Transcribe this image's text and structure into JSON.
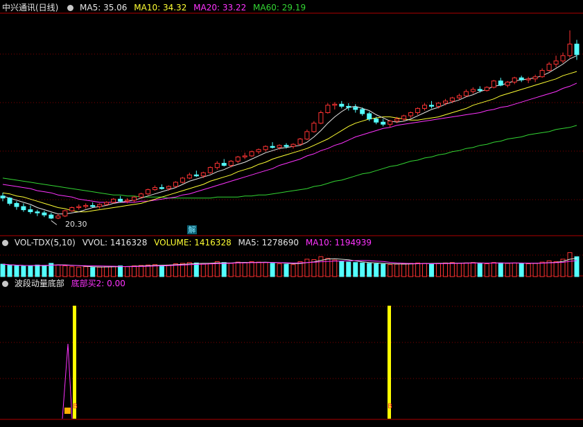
{
  "main": {
    "title": "中兴通讯(日线)",
    "ma5": "MA5: 35.06",
    "ma10": "MA10: 34.32",
    "ma20": "MA20: 33.22",
    "ma60": "MA60: 29.19",
    "low_label": "20.30",
    "unlock_label": "解"
  },
  "volume": {
    "title": "VOL-TDX(5,10)",
    "vvol": "VVOL: 1416328",
    "vol": "VOLUME: 1416328",
    "ma5": "MA5: 1278690",
    "ma10": "MA10: 1194939"
  },
  "indicator": {
    "title": "波段动量底部",
    "buy2": "底部买2: 0.00",
    "marker": "B"
  },
  "colors": {
    "up": "#ff3333",
    "down": "#54ffff",
    "ma5": "#e6e6e6",
    "ma10": "#ffff33",
    "ma20": "#ff33ff",
    "ma60": "#33d633",
    "grid": "#880000",
    "signal": "#ffff00"
  },
  "chart_data": [
    {
      "type": "candlestick",
      "name": "price",
      "low_marked": 20.3,
      "ohlc": [
        [
          22.5,
          22.8,
          22.0,
          22.3
        ],
        [
          22.3,
          22.4,
          21.6,
          21.8
        ],
        [
          21.8,
          22.0,
          21.2,
          21.5
        ],
        [
          21.5,
          21.8,
          21.0,
          21.2
        ],
        [
          21.2,
          21.6,
          20.8,
          21.0
        ],
        [
          21.0,
          21.2,
          20.6,
          20.9
        ],
        [
          20.9,
          21.1,
          20.5,
          20.7
        ],
        [
          20.7,
          20.9,
          20.3,
          20.4
        ],
        [
          20.4,
          20.8,
          20.3,
          20.6
        ],
        [
          20.6,
          21.2,
          20.5,
          21.1
        ],
        [
          21.1,
          21.5,
          21.0,
          21.4
        ],
        [
          21.4,
          21.7,
          21.2,
          21.5
        ],
        [
          21.5,
          21.8,
          21.3,
          21.6
        ],
        [
          21.6,
          21.9,
          21.4,
          21.5
        ],
        [
          21.5,
          21.8,
          21.3,
          21.7
        ],
        [
          21.7,
          22.0,
          21.6,
          21.9
        ],
        [
          21.9,
          22.3,
          21.8,
          22.2
        ],
        [
          22.2,
          22.5,
          21.9,
          22.0
        ],
        [
          22.0,
          22.3,
          21.8,
          22.1
        ],
        [
          22.1,
          22.5,
          21.9,
          22.4
        ],
        [
          22.4,
          22.8,
          22.3,
          22.7
        ],
        [
          22.7,
          23.2,
          22.6,
          23.1
        ],
        [
          23.1,
          23.5,
          23.0,
          23.3
        ],
        [
          23.3,
          23.6,
          23.1,
          23.2
        ],
        [
          23.2,
          23.5,
          23.0,
          23.4
        ],
        [
          23.4,
          23.9,
          23.3,
          23.8
        ],
        [
          23.8,
          24.3,
          23.7,
          24.2
        ],
        [
          24.2,
          24.7,
          24.1,
          24.5
        ],
        [
          24.5,
          24.9,
          24.3,
          24.4
        ],
        [
          24.4,
          24.8,
          24.2,
          24.7
        ],
        [
          24.7,
          25.3,
          24.6,
          25.2
        ],
        [
          25.2,
          25.8,
          25.0,
          25.6
        ],
        [
          25.6,
          26.0,
          25.3,
          25.4
        ],
        [
          25.4,
          25.9,
          25.2,
          25.8
        ],
        [
          25.8,
          26.3,
          25.6,
          26.2
        ],
        [
          26.2,
          26.6,
          26.0,
          26.3
        ],
        [
          26.3,
          26.8,
          26.2,
          26.7
        ],
        [
          26.7,
          27.0,
          26.5,
          26.9
        ],
        [
          26.9,
          27.3,
          26.7,
          27.2
        ],
        [
          27.2,
          27.6,
          27.0,
          27.1
        ],
        [
          27.1,
          27.4,
          26.9,
          27.3
        ],
        [
          27.3,
          27.5,
          27.0,
          27.2
        ],
        [
          27.2,
          27.5,
          27.0,
          27.4
        ],
        [
          27.4,
          28.0,
          27.3,
          27.9
        ],
        [
          27.9,
          28.8,
          27.8,
          28.6
        ],
        [
          28.6,
          29.6,
          28.5,
          29.4
        ],
        [
          29.4,
          30.6,
          29.3,
          30.4
        ],
        [
          30.4,
          31.3,
          30.3,
          31.1
        ],
        [
          31.1,
          31.4,
          30.7,
          31.2
        ],
        [
          31.2,
          31.5,
          30.8,
          31.0
        ],
        [
          31.0,
          31.3,
          30.6,
          30.9
        ],
        [
          30.9,
          31.2,
          30.4,
          30.7
        ],
        [
          30.7,
          30.9,
          30.1,
          30.3
        ],
        [
          30.3,
          30.5,
          29.6,
          29.8
        ],
        [
          29.8,
          30.0,
          29.3,
          29.5
        ],
        [
          29.5,
          29.8,
          29.1,
          29.3
        ],
        [
          29.3,
          29.7,
          29.0,
          29.6
        ],
        [
          29.6,
          30.0,
          29.4,
          29.8
        ],
        [
          29.8,
          30.2,
          29.6,
          30.1
        ],
        [
          30.1,
          30.5,
          29.9,
          30.4
        ],
        [
          30.4,
          30.9,
          30.2,
          30.8
        ],
        [
          30.8,
          31.3,
          30.6,
          31.1
        ],
        [
          31.1,
          31.5,
          30.8,
          31.0
        ],
        [
          31.0,
          31.4,
          30.8,
          31.3
        ],
        [
          31.3,
          31.7,
          31.1,
          31.5
        ],
        [
          31.5,
          31.9,
          31.3,
          31.8
        ],
        [
          31.8,
          32.2,
          31.6,
          32.0
        ],
        [
          32.0,
          32.6,
          31.9,
          32.4
        ],
        [
          32.4,
          32.8,
          32.2,
          32.6
        ],
        [
          32.6,
          32.9,
          32.3,
          32.5
        ],
        [
          32.5,
          32.9,
          32.4,
          32.8
        ],
        [
          32.8,
          33.5,
          32.7,
          33.4
        ],
        [
          33.4,
          33.7,
          32.9,
          33.0
        ],
        [
          33.0,
          33.4,
          32.8,
          33.3
        ],
        [
          33.3,
          33.8,
          33.1,
          33.7
        ],
        [
          33.7,
          33.9,
          33.3,
          33.5
        ],
        [
          33.5,
          33.8,
          33.2,
          33.6
        ],
        [
          33.6,
          34.0,
          33.3,
          33.8
        ],
        [
          33.8,
          34.6,
          33.7,
          34.4
        ],
        [
          34.4,
          35.2,
          34.3,
          35.0
        ],
        [
          35.0,
          35.8,
          34.7,
          35.3
        ],
        [
          35.3,
          36.1,
          35.1,
          35.8
        ],
        [
          35.8,
          38.2,
          35.6,
          36.9
        ],
        [
          36.9,
          37.3,
          35.4,
          35.9
        ]
      ],
      "ma5": [
        22.5,
        22.3,
        22.1,
        21.9,
        21.7,
        21.4,
        21.2,
        21.0,
        20.8,
        20.8,
        20.9,
        21.0,
        21.2,
        21.4,
        21.5,
        21.6,
        21.8,
        21.9,
        22.0,
        22.1,
        22.3,
        22.5,
        22.7,
        22.9,
        23.1,
        23.3,
        23.6,
        23.9,
        24.1,
        24.3,
        24.5,
        24.8,
        25.0,
        25.3,
        25.5,
        25.7,
        26.0,
        26.3,
        26.6,
        26.8,
        27.0,
        27.1,
        27.2,
        27.3,
        27.6,
        28.1,
        28.7,
        29.4,
        30.0,
        30.5,
        30.9,
        31.0,
        30.8,
        30.6,
        30.2,
        29.9,
        29.6,
        29.5,
        29.6,
        29.8,
        30.1,
        30.4,
        30.7,
        30.9,
        31.2,
        31.4,
        31.6,
        31.9,
        32.1,
        32.4,
        32.6,
        32.9,
        33.0,
        33.2,
        33.4,
        33.5,
        33.6,
        33.7,
        33.9,
        34.2,
        34.6,
        35.0,
        35.5,
        35.8
      ],
      "ma10": [
        22.8,
        22.7,
        22.5,
        22.4,
        22.2,
        22.0,
        21.8,
        21.6,
        21.4,
        21.3,
        21.1,
        21.0,
        21.0,
        21.1,
        21.2,
        21.3,
        21.4,
        21.5,
        21.6,
        21.7,
        21.8,
        22.0,
        22.2,
        22.4,
        22.6,
        22.8,
        23.0,
        23.2,
        23.4,
        23.6,
        23.9,
        24.1,
        24.3,
        24.5,
        24.8,
        25.0,
        25.2,
        25.5,
        25.7,
        26.0,
        26.2,
        26.4,
        26.6,
        26.8,
        27.0,
        27.3,
        27.6,
        27.9,
        28.3,
        28.7,
        29.1,
        29.4,
        29.6,
        29.8,
        29.9,
        30.0,
        30.0,
        29.9,
        29.8,
        29.7,
        29.7,
        29.8,
        29.9,
        30.0,
        30.2,
        30.4,
        30.6,
        30.8,
        31.1,
        31.3,
        31.5,
        31.7,
        32.0,
        32.2,
        32.4,
        32.6,
        32.8,
        33.0,
        33.2,
        33.4,
        33.6,
        33.9,
        34.1,
        34.3
      ],
      "ma20": [
        23.6,
        23.5,
        23.4,
        23.3,
        23.2,
        23.0,
        22.9,
        22.8,
        22.6,
        22.5,
        22.4,
        22.2,
        22.1,
        22.0,
        21.9,
        21.9,
        21.9,
        21.9,
        21.9,
        21.9,
        22.0,
        22.0,
        22.1,
        22.2,
        22.3,
        22.4,
        22.6,
        22.7,
        22.9,
        23.1,
        23.3,
        23.5,
        23.7,
        23.9,
        24.1,
        24.3,
        24.5,
        24.7,
        24.9,
        25.1,
        25.4,
        25.6,
        25.8,
        26.0,
        26.3,
        26.5,
        26.8,
        27.0,
        27.3,
        27.5,
        27.8,
        28.1,
        28.3,
        28.5,
        28.7,
        28.9,
        29.0,
        29.2,
        29.3,
        29.4,
        29.5,
        29.6,
        29.7,
        29.8,
        29.9,
        30.0,
        30.1,
        30.2,
        30.3,
        30.4,
        30.6,
        30.7,
        30.9,
        31.0,
        31.2,
        31.4,
        31.6,
        31.8,
        32.0,
        32.2,
        32.4,
        32.7,
        32.9,
        33.2
      ],
      "ma60": [
        24.2,
        24.1,
        24.0,
        23.9,
        23.8,
        23.7,
        23.6,
        23.5,
        23.4,
        23.3,
        23.2,
        23.1,
        23.0,
        22.9,
        22.8,
        22.7,
        22.6,
        22.6,
        22.5,
        22.5,
        22.4,
        22.4,
        22.4,
        22.4,
        22.3,
        22.3,
        22.3,
        22.3,
        22.3,
        22.3,
        22.3,
        22.4,
        22.4,
        22.4,
        22.4,
        22.5,
        22.5,
        22.6,
        22.6,
        22.7,
        22.8,
        22.9,
        23.0,
        23.1,
        23.2,
        23.4,
        23.5,
        23.7,
        23.9,
        24.0,
        24.2,
        24.4,
        24.6,
        24.7,
        24.9,
        25.1,
        25.3,
        25.4,
        25.6,
        25.8,
        25.9,
        26.1,
        26.2,
        26.4,
        26.5,
        26.7,
        26.8,
        27.0,
        27.1,
        27.3,
        27.4,
        27.6,
        27.7,
        27.9,
        28.0,
        28.1,
        28.3,
        28.4,
        28.5,
        28.6,
        28.8,
        28.9,
        29.0,
        29.19
      ]
    },
    {
      "type": "bar",
      "name": "volume",
      "values": [
        1.0,
        0.85,
        0.8,
        0.75,
        0.8,
        0.9,
        0.85,
        1.1,
        0.9,
        0.8,
        0.7,
        0.65,
        0.7,
        0.6,
        0.65,
        0.7,
        0.75,
        0.8,
        0.7,
        0.8,
        0.85,
        0.9,
        0.95,
        0.85,
        0.9,
        1.05,
        1.1,
        1.2,
        1.15,
        1.0,
        1.1,
        1.3,
        1.2,
        1.1,
        1.25,
        1.2,
        1.3,
        1.25,
        1.2,
        1.1,
        1.05,
        1.0,
        0.95,
        1.3,
        1.6,
        1.55,
        1.9,
        1.7,
        1.5,
        1.3,
        1.25,
        1.2,
        1.15,
        1.1,
        1.05,
        1.0,
        0.95,
        1.0,
        1.05,
        1.1,
        1.15,
        1.1,
        1.05,
        1.1,
        1.15,
        1.2,
        1.1,
        1.15,
        1.2,
        1.1,
        1.05,
        1.2,
        1.15,
        1.1,
        1.15,
        1.1,
        1.05,
        1.1,
        1.25,
        1.4,
        1.3,
        1.6,
        2.4,
        1.9
      ]
    },
    {
      "type": "line",
      "name": "momentum",
      "x": [
        90,
        98,
        104
      ],
      "values": [
        0,
        1.0,
        0
      ],
      "signals_x": [
        107,
        561
      ]
    }
  ]
}
